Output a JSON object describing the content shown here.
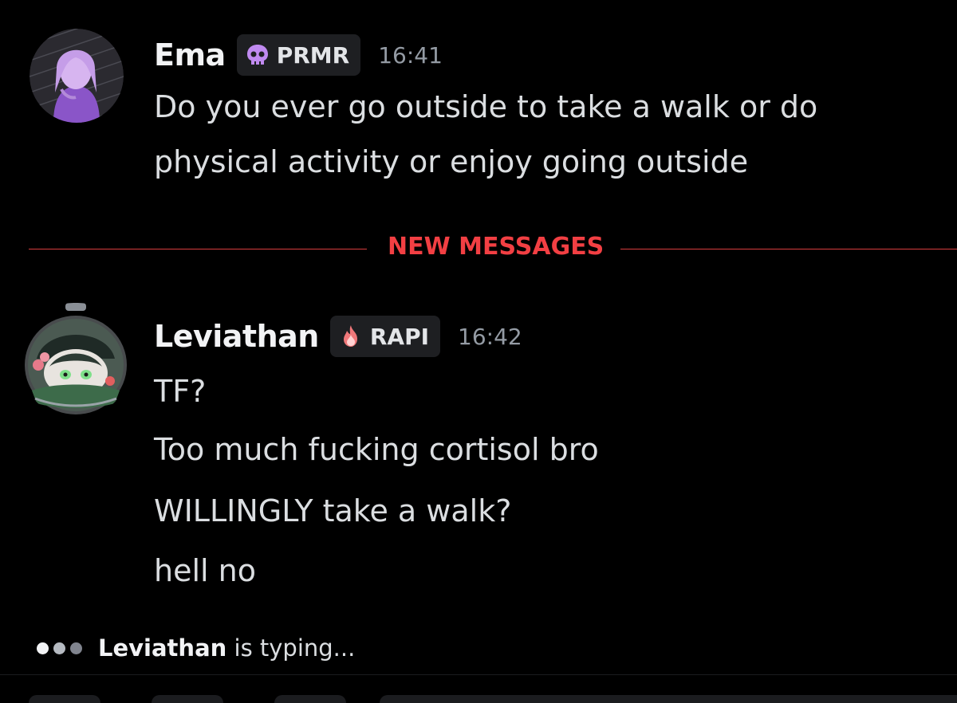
{
  "messages": [
    {
      "username": "Ema",
      "tag": "PRMR",
      "tag_icon": "skull-icon",
      "time": "16:41",
      "lines": [
        "Do you ever go outside to take a walk or do",
        "physical activity or enjoy going outside"
      ]
    },
    {
      "username": "Leviathan",
      "tag": "RAPI",
      "tag_icon": "flame-icon",
      "time": "16:42",
      "lines": [
        "TF?",
        "Too much fucking cortisol bro",
        "WILLINGLY take a walk?",
        "hell no"
      ]
    }
  ],
  "divider": {
    "label": "NEW MESSAGES"
  },
  "typing": {
    "user": "Leviathan",
    "suffix": "is typing..."
  },
  "colors": {
    "background": "#000000",
    "new_messages": "#f23f43",
    "tag_bg": "#1e1f22",
    "skull": "#c08af0",
    "flame": "#f0787a"
  }
}
